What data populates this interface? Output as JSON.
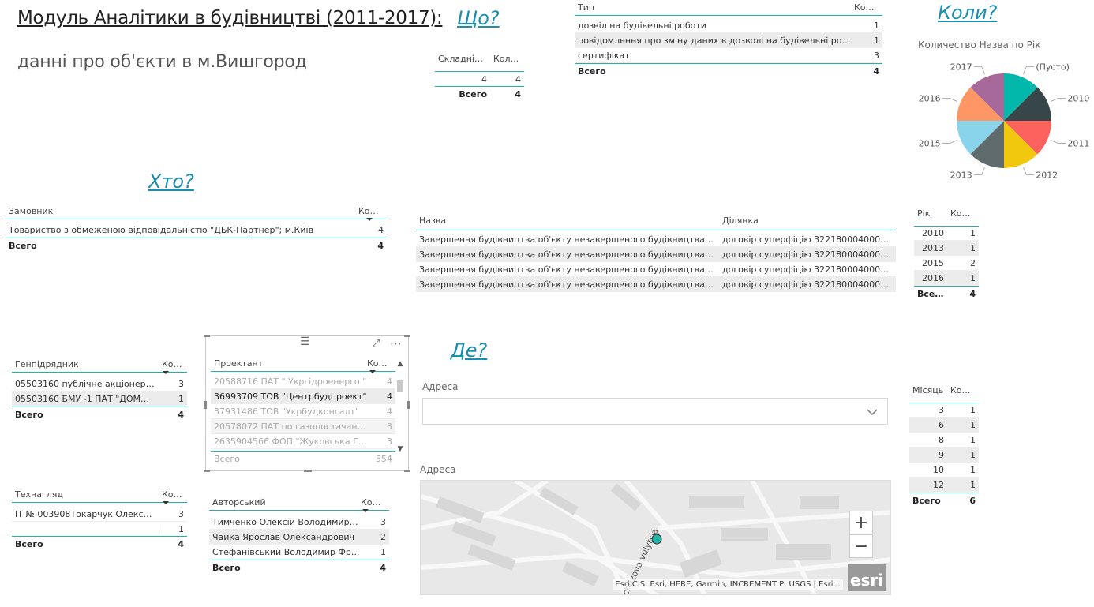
{
  "header": {
    "title": "Модуль Аналітики в будівництві (2011-2017):",
    "subtitle": "данні про об'єкти в м.Вишгород"
  },
  "questions": {
    "what": "Що?",
    "when": "Коли?",
    "who": "Хто?",
    "where": "Де?"
  },
  "complexity_table": {
    "headers": [
      "Складність",
      "Кол..."
    ],
    "rows": [
      [
        "4",
        "4"
      ]
    ],
    "total": [
      "Всего",
      "4"
    ]
  },
  "type_table": {
    "headers": [
      "Тип",
      "Кол..."
    ],
    "rows": [
      [
        "дозвіл на будівельні роботи",
        "1"
      ],
      [
        "повідомлення про зміну даних в дозволі на будівельні робот...",
        "1"
      ],
      [
        "сертифікат",
        "3"
      ]
    ],
    "total": [
      "Всего",
      "4"
    ]
  },
  "customer_table": {
    "headers": [
      "Замовник",
      "Кол..."
    ],
    "rows": [
      [
        "Товариство з обмеженою відповідальністю \"ДБК-Партнер\"; м.Київ",
        "4"
      ]
    ],
    "total": [
      "Всего",
      "4"
    ]
  },
  "name_table": {
    "headers": [
      "Назва",
      "Ділянка"
    ],
    "rows": [
      [
        "Завершення будівництва об'єкту незавершеного будівництва та жи...",
        "договір суперфіцію  322180004000123..."
      ],
      [
        "Завершення будівництва об'єкту незавершеного будівництва та жи...",
        "договір суперфіцію  322180004000123..."
      ],
      [
        "Завершення будівництва об'єкту незавершеного будівництва та жи...",
        "договір суперфіцію  322180004000123..."
      ],
      [
        "Завершення будівництва об'єкту незавершеного будівництва та жи...",
        "договір суперфіцію  322180004000123..."
      ]
    ]
  },
  "year_table": {
    "headers": [
      "Рік",
      "Кол..."
    ],
    "rows": [
      [
        "2010",
        "1"
      ],
      [
        "2013",
        "1"
      ],
      [
        "2015",
        "2"
      ],
      [
        "2016",
        "1"
      ]
    ],
    "total": [
      "Всего",
      "4"
    ]
  },
  "contractor_table": {
    "headers": [
      "Генпідрядник",
      "Кол..."
    ],
    "rows": [
      [
        "05503160 публічне акціонерне...",
        "3"
      ],
      [
        "05503160 БМУ -1 ПАТ \"ДОМОБ...",
        "1"
      ]
    ],
    "total": [
      "Всего",
      "4"
    ]
  },
  "designer_table": {
    "headers": [
      "Проектант",
      "Кол..."
    ],
    "rows": [
      [
        "20588716 ПАТ \" Укргідроенерго \"",
        "4"
      ],
      [
        "36993709 ТОВ \"Центрбудпроект\"",
        "4"
      ],
      [
        "37931486 ТОВ \"Укрбудконсалт\"",
        "4"
      ],
      [
        "20578072 ПАТ  по газопостачан...",
        "3"
      ],
      [
        "2635904566 ФОП \"Жуковська Га...",
        "3"
      ]
    ],
    "total": [
      "Всего",
      "554"
    ]
  },
  "supervision_table": {
    "headers": [
      "Технагляд",
      "Кол..."
    ],
    "rows": [
      [
        "ІТ № 003908Токарчук Олексан...",
        "3"
      ],
      [
        "",
        "1"
      ]
    ],
    "total": [
      "Всего",
      "4"
    ]
  },
  "author_table": {
    "headers": [
      "Авторський",
      "Кол..."
    ],
    "rows": [
      [
        "Тимченко Олексій Володимиро...",
        "3"
      ],
      [
        "Чайка Ярослав Олександрович",
        "2"
      ],
      [
        "Стефанівський  Володимир Фр...",
        "1"
      ]
    ],
    "total": [
      "Всего",
      "4"
    ]
  },
  "month_table": {
    "headers": [
      "Місяць",
      "Кол..."
    ],
    "rows": [
      [
        "3",
        "1"
      ],
      [
        "6",
        "1"
      ],
      [
        "8",
        "1"
      ],
      [
        "9",
        "1"
      ],
      [
        "10",
        "1"
      ],
      [
        "12",
        "1"
      ]
    ],
    "total": [
      "Всего",
      "6"
    ]
  },
  "address_filter": {
    "label": "Адреса",
    "value": ""
  },
  "map": {
    "label": "Адреса",
    "street_label": "chuzova vulytsia",
    "attribution": "Esri CIS, Esri, HERE, Garmin, INCREMENT P, USGS | Esri...",
    "logo": "esri",
    "zoom_in": "+",
    "zoom_out": "−"
  },
  "pie_chart": {
    "title": "Количество Назва по Рік"
  },
  "chart_data": {
    "type": "pie",
    "title": "Количество Назва по Рік",
    "categories": [
      "(Пусто)",
      "2010",
      "2011",
      "2012",
      "2013",
      "2015",
      "2016",
      "2017"
    ],
    "values": [
      1,
      1,
      1,
      1,
      1,
      1,
      1,
      1
    ],
    "colors": [
      "#01b8aa",
      "#374649",
      "#fd625e",
      "#f2c80f",
      "#5f6b6d",
      "#8ad4eb",
      "#fe9666",
      "#a66999"
    ]
  },
  "icons": {
    "focus_mode": "focus-mode-icon",
    "more_options": "more-options-icon",
    "drag": "drag-handle-icon",
    "chevron": "chevron-down-icon"
  }
}
